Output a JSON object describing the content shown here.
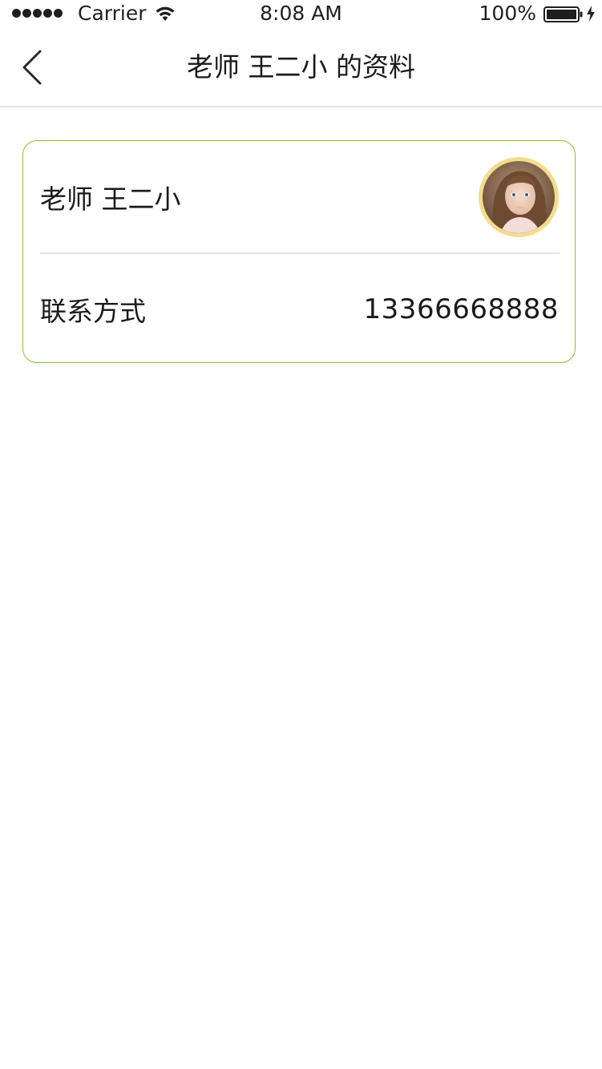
{
  "status_bar": {
    "carrier": "Carrier",
    "time": "8:08 AM",
    "battery_percent": "100%",
    "signal_icon": "signal-dots-icon",
    "wifi_icon": "wifi-icon",
    "battery_icon": "battery-full-icon",
    "charging_icon": "charging-bolt-icon"
  },
  "nav": {
    "title": "老师 王二小 的资料",
    "back_icon": "chevron-left-icon"
  },
  "profile": {
    "name": "老师 王二小",
    "avatar_icon": "avatar-photo",
    "contact_label": "联系方式",
    "contact_value": "13366668888"
  },
  "colors": {
    "card_border": "#8cbf26",
    "avatar_ring": "#f3dc8e",
    "divider": "#e3e3e3",
    "text": "#1a1a1a"
  }
}
